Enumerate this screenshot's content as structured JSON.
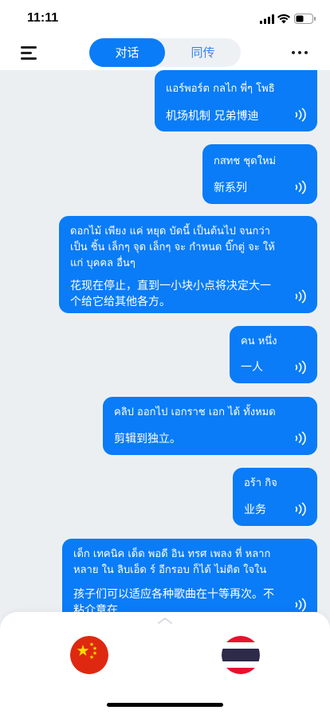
{
  "status_bar": {
    "time": "11:11"
  },
  "nav": {
    "tabs": [
      {
        "label": "对话",
        "active": true
      },
      {
        "label": "同传",
        "active": false
      }
    ]
  },
  "colors": {
    "accent": "#0a7cf7",
    "bubble_text": "#ffffff",
    "background": "#eceff2"
  },
  "messages": [
    {
      "source": "แอร์พอร์ต กลไก พี่ๆ โพธิ",
      "translation": "机场机制 兄弟博迪"
    },
    {
      "source": "กสทช ชุดใหม่",
      "translation": "新系列"
    },
    {
      "source": [
        "ดอกไม้ เพียง แค่ หยุด บัดนี้ เป็นต้นไป จนกว่า",
        "เป็น ชิ้น เล็กๆ จุด เล็กๆ จะ กำหนด บิ๊กตู่ จะ ให้",
        "แก่ บุคคล อื่นๆ"
      ],
      "translation": [
        "花现在停止，直到一小块小点将决定大一",
        "个给它给其他各方。"
      ]
    },
    {
      "source": "คน หนึ่ง",
      "translation": "一人"
    },
    {
      "source": "คลิป ออกไป เอกราช เอก ได้ ทั้งหมด",
      "translation": "剪辑到独立。"
    },
    {
      "source": "อร้า กิจ",
      "translation": "业务"
    },
    {
      "source": [
        "เด็ก เทคนิค เด็ด พอดี อิน ทรศ เพลง ที่ หลาก",
        "หลาย ใน ลิบเอ็ด ร์ อีกรอบ ก็ได้ ไม่ติด ใจใน"
      ],
      "translation": [
        "孩子们可以适应各种歌曲在十等再次。不",
        "粘介意在"
      ]
    }
  ],
  "bottom_panel": {
    "left_language_icon": "china-flag-icon",
    "right_language_icon": "thailand-flag-icon"
  }
}
